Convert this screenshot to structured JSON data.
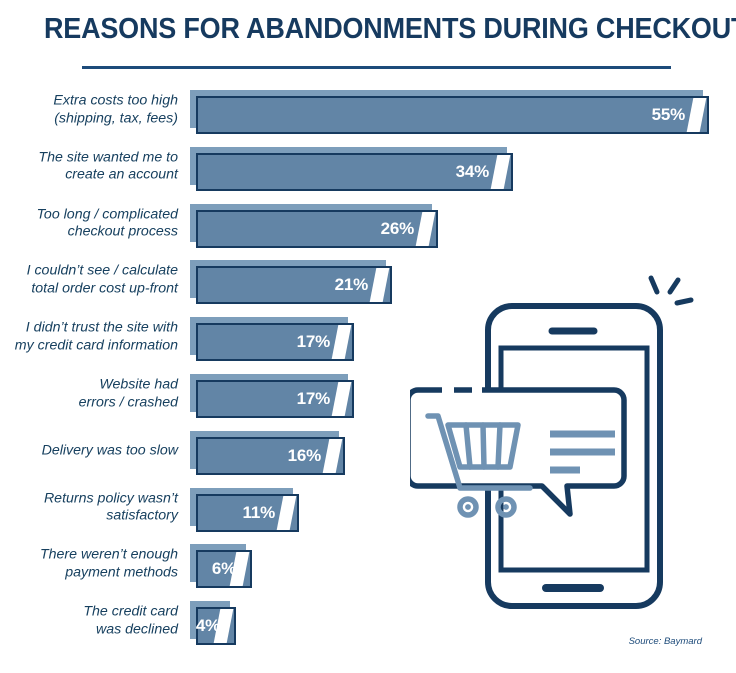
{
  "header": {
    "title": "REASONS FOR ABANDONMENTS DURING CHECKOUT"
  },
  "source": {
    "text": "Source: Baymard"
  },
  "colors": {
    "navy": "#163a5f",
    "bar_fill": "#6285a6",
    "bar_shadow": "#7d9ebb",
    "rule": "#1d4b7a",
    "background": "#ffffff",
    "value_text": "#ffffff"
  },
  "illustration": {
    "phone_label": "smartphone-outline",
    "bubble_label": "speech-bubble",
    "cart_label": "shopping-cart-icon",
    "sparkle_label": "notification-sparkle"
  },
  "chart_data": {
    "type": "bar",
    "orientation": "horizontal",
    "title": "REASONS FOR ABANDONMENTS DURING CHECKOUT",
    "xlabel": "",
    "ylabel": "",
    "value_suffix": "%",
    "xlim": [
      0,
      58
    ],
    "grid": false,
    "legend": false,
    "source": "Source: Baymard",
    "categories": [
      "Extra costs too high\n(shipping, tax, fees)",
      "The site wanted me to\ncreate an account",
      "Too long / complicated\ncheckout process",
      "I couldn’t see / calculate\ntotal order cost up-front",
      "I didn’t trust the site with\nmy credit card information",
      "Website had\nerrors / crashed",
      "Delivery was too slow",
      "Returns policy wasn’t\nsatisfactory",
      "There weren’t enough\npayment methods",
      "The credit card\nwas declined"
    ],
    "values": [
      55,
      34,
      26,
      21,
      17,
      17,
      16,
      11,
      6,
      4
    ],
    "labels": [
      "55%",
      "34%",
      "26%",
      "21%",
      "17%",
      "17%",
      "16%",
      "11%",
      "6%",
      "4%"
    ]
  }
}
